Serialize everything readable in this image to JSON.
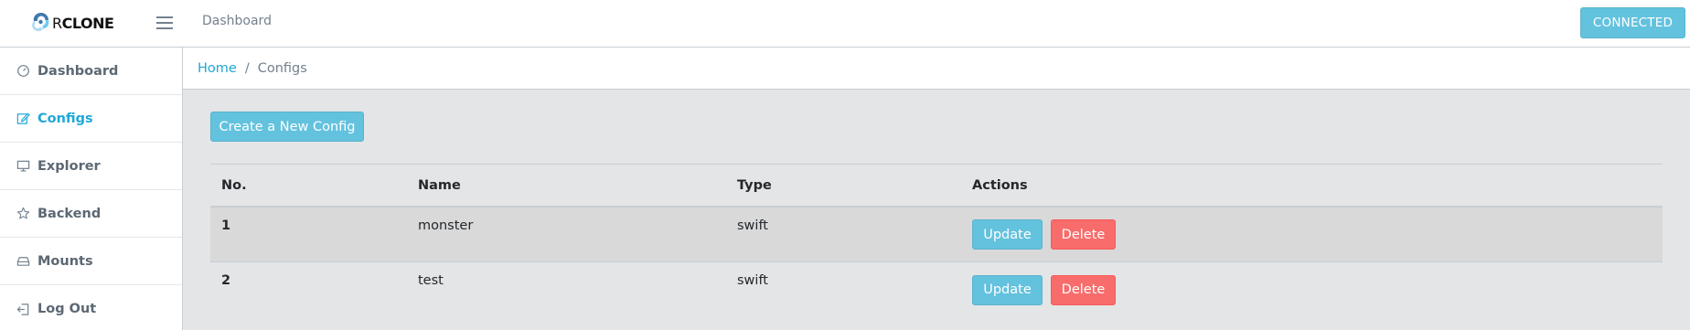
{
  "brand": {
    "r": "R",
    "rest": "CLONE"
  },
  "header": {
    "nav_link": "Dashboard",
    "connection_status": "CONNECTED"
  },
  "sidebar": {
    "items": [
      {
        "label": "Dashboard",
        "icon": "speedometer-icon"
      },
      {
        "label": "Configs",
        "icon": "pencil-icon",
        "active": true
      },
      {
        "label": "Explorer",
        "icon": "monitor-icon"
      },
      {
        "label": "Backend",
        "icon": "star-icon"
      },
      {
        "label": "Mounts",
        "icon": "drive-icon"
      },
      {
        "label": "Log Out",
        "icon": "logout-icon"
      }
    ]
  },
  "breadcrumb": {
    "home": "Home",
    "separator": "/",
    "current": "Configs"
  },
  "main": {
    "create_button": "Create a New Config",
    "table": {
      "headers": [
        "No.",
        "Name",
        "Type",
        "Actions"
      ],
      "rows": [
        {
          "no": "1",
          "name": "monster",
          "type": "swift",
          "update": "Update",
          "delete": "Delete"
        },
        {
          "no": "2",
          "name": "test",
          "type": "swift",
          "update": "Update",
          "delete": "Delete"
        }
      ]
    }
  },
  "colors": {
    "accent": "#20a8d8",
    "info_button": "#63c2de",
    "danger_button": "#f86c6b",
    "page_background": "#e4e5e6"
  }
}
